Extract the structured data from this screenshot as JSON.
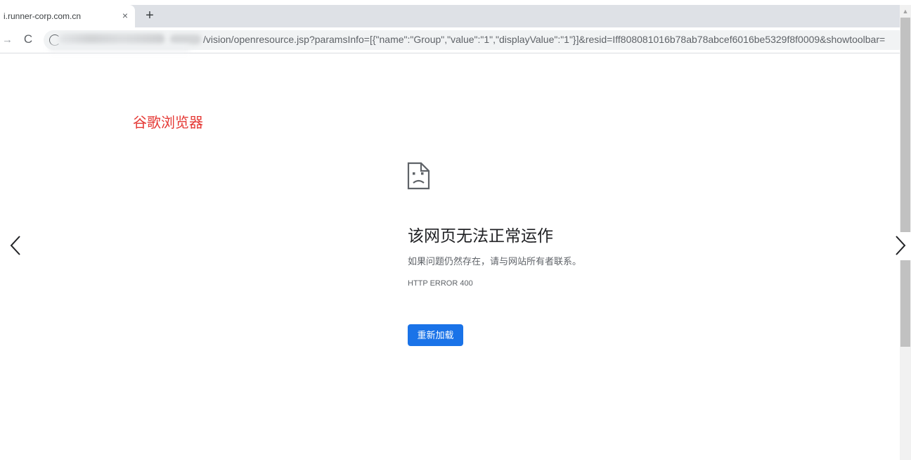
{
  "browser": {
    "tab": {
      "title": "i.runner-corp.com.cn",
      "close_glyph": "×"
    },
    "new_tab_glyph": "+",
    "toolbar": {
      "forward_icon": "forward-arrow-icon",
      "reload_icon": "reload-icon",
      "reload_glyph": "C",
      "forward_glyph": "→"
    },
    "omnibox": {
      "url_visible": "/vision/openresource.jsp?paramsInfo=[{\"name\":\"Group\",\"value\":\"1\",\"displayValue\":\"1\"}]&resid=Iff808081016b78ab78abcef6016be5329f8f0009&showtoolbar="
    }
  },
  "annotation": {
    "text": "谷歌浏览器",
    "color": "#e53935"
  },
  "error_page": {
    "icon": "sad-page-icon",
    "title": "该网页无法正常运作",
    "description": "如果问题仍然存在，请与网站所有者联系。",
    "code": "HTTP ERROR 400",
    "reload_button": "重新加载",
    "accent": "#1a73e8"
  },
  "navigation": {
    "prev_icon": "chevron-left-icon",
    "next_icon": "chevron-right-icon"
  },
  "scrollbar": {
    "up_glyph": "▲"
  }
}
